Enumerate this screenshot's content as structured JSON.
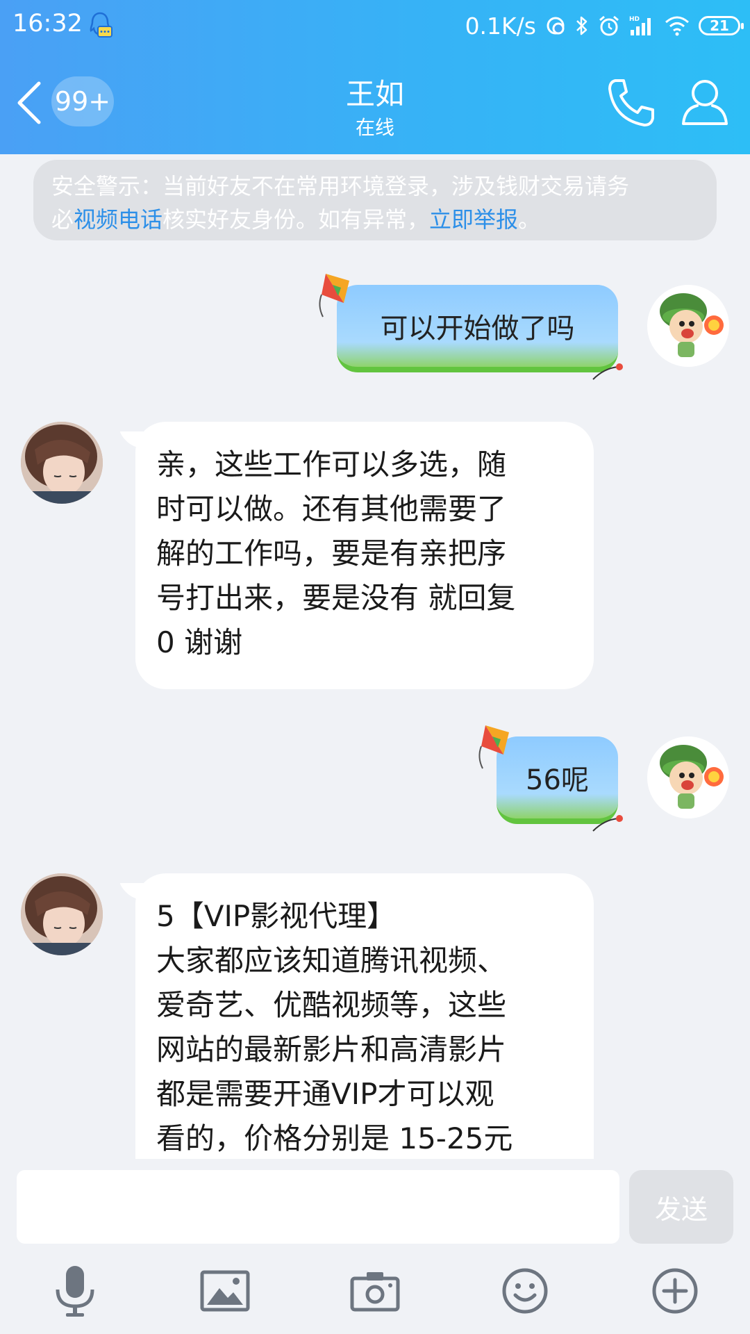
{
  "status_bar": {
    "time": "16:32",
    "network_speed": "0.1K/s",
    "battery": "21",
    "icons": [
      "qq-notification-icon",
      "data-saver-icon",
      "bluetooth-icon",
      "alarm-icon",
      "hd-signal-icon",
      "wifi-icon",
      "battery-icon"
    ]
  },
  "header": {
    "unread_count": "99+",
    "contact_name": "王如",
    "contact_status": "在线",
    "icons": [
      "back-icon",
      "phone-icon",
      "profile-icon"
    ]
  },
  "security_banner": {
    "line1": "安全警示：当前好友不在常用环境登录，涉及钱财交易请务",
    "line2_prefix": "必",
    "link1": "视频电话",
    "line2_middle": "核实好友身份。如有异常，",
    "link2": "立即举报",
    "line2_suffix": "。"
  },
  "messages": [
    {
      "sender": "me",
      "text": "可以开始做了吗"
    },
    {
      "sender": "other",
      "lines": [
        "亲，这些工作可以多选，随",
        "时可以做。还有其他需要了",
        "解的工作吗，要是有亲把序",
        "号打出来，要是没有 就回复",
        "0 谢谢"
      ]
    },
    {
      "sender": "me",
      "text": "56呢"
    },
    {
      "sender": "other",
      "lines": [
        "5【VIP影视代理】",
        "大家都应该知道腾讯视频、",
        "爱奇艺、优酷视频等，这些",
        "网站的最新影片和高清影片",
        "都是需要开通VIP才可以观",
        "看的，价格分别是 15-25元"
      ]
    }
  ],
  "input": {
    "placeholder": "",
    "send_label": "发送"
  },
  "toolbar": {
    "icons": [
      "microphone-icon",
      "image-icon",
      "camera-icon",
      "emoji-icon",
      "plus-icon"
    ]
  },
  "colors": {
    "header_start": "#4aa0f5",
    "header_end": "#2dbef6",
    "link": "#2c8fe8",
    "bubble_out": "#a9dafe",
    "background": "#f0f2f6"
  }
}
